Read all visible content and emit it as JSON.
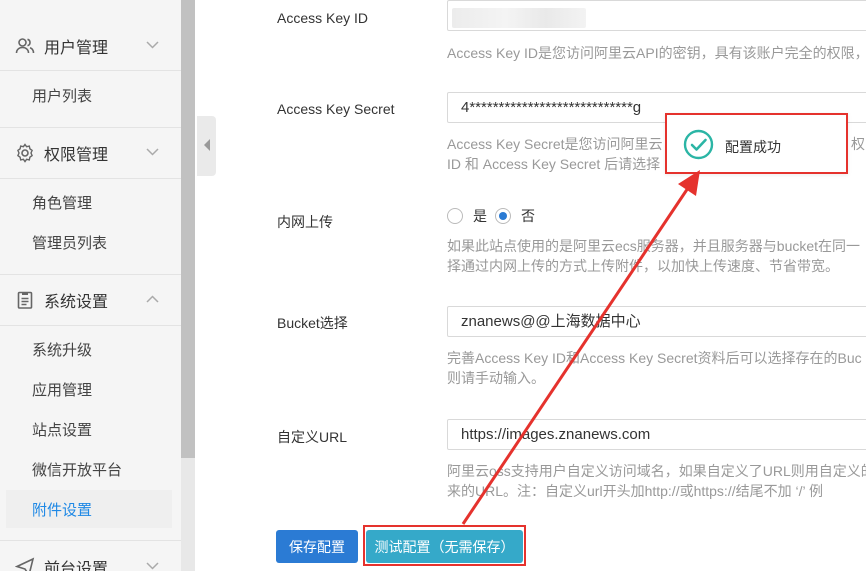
{
  "sidebar": {
    "groups": [
      {
        "label": "用户管理",
        "icon": "user-group-icon",
        "items": [
          {
            "label": "用户列表"
          }
        ]
      },
      {
        "label": "权限管理",
        "icon": "gear-icon",
        "items": [
          {
            "label": "角色管理"
          },
          {
            "label": "管理员列表"
          }
        ]
      },
      {
        "label": "系统设置",
        "icon": "clipboard-icon",
        "items": [
          {
            "label": "系统升级"
          },
          {
            "label": "应用管理"
          },
          {
            "label": "站点设置"
          },
          {
            "label": "微信开放平台"
          },
          {
            "label": "附件设置"
          }
        ]
      },
      {
        "label": "前台设置",
        "icon": "paper-plane-icon",
        "items": []
      }
    ],
    "active_item": "附件设置",
    "accent_color": "#1e88e5"
  },
  "form": {
    "access_key_id": {
      "label": "Access Key ID",
      "value": "",
      "help": "Access Key ID是您访问阿里云API的密钥，具有该账户完全的权限，"
    },
    "access_key_secret": {
      "label": "Access Key Secret",
      "value": "4****************************g",
      "help_line1": "Access Key Secret是您访问阿里云",
      "help_line1_tail": "权",
      "help_line2": "ID 和 Access Key Secret 后请选择"
    },
    "intranet_upload": {
      "label": "内网上传",
      "options": [
        "是",
        "否"
      ],
      "selected": "否",
      "help_line1": "如果此站点使用的是阿里云ecs服务器，并且服务器与bucket在同一",
      "help_line2": "择通过内网上传的方式上传附件，以加快上传速度、节省带宽。"
    },
    "bucket": {
      "label": "Bucket选择",
      "value": "znanews@@上海数据中心",
      "help_line1": "完善Access Key ID和Access Key Secret资料后可以选择存在的Buc",
      "help_line2": "则请手动输入。"
    },
    "custom_url": {
      "label": "自定义URL",
      "value": "https://images.znanews.com",
      "help_line1": "阿里云oss支持用户自定义访问域名，如果自定义了URL则用自定义的",
      "help_line2": "来的URL。注：自定义url开头加http://或https://结尾不加 ‘/’ 例"
    },
    "buttons": {
      "save": "保存配置",
      "test": "测试配置（无需保存）"
    }
  },
  "toast": {
    "message": "配置成功",
    "icon": "check-circle-icon",
    "icon_color": "#2bb5a5"
  },
  "annotation": {
    "color": "#e5322d"
  }
}
